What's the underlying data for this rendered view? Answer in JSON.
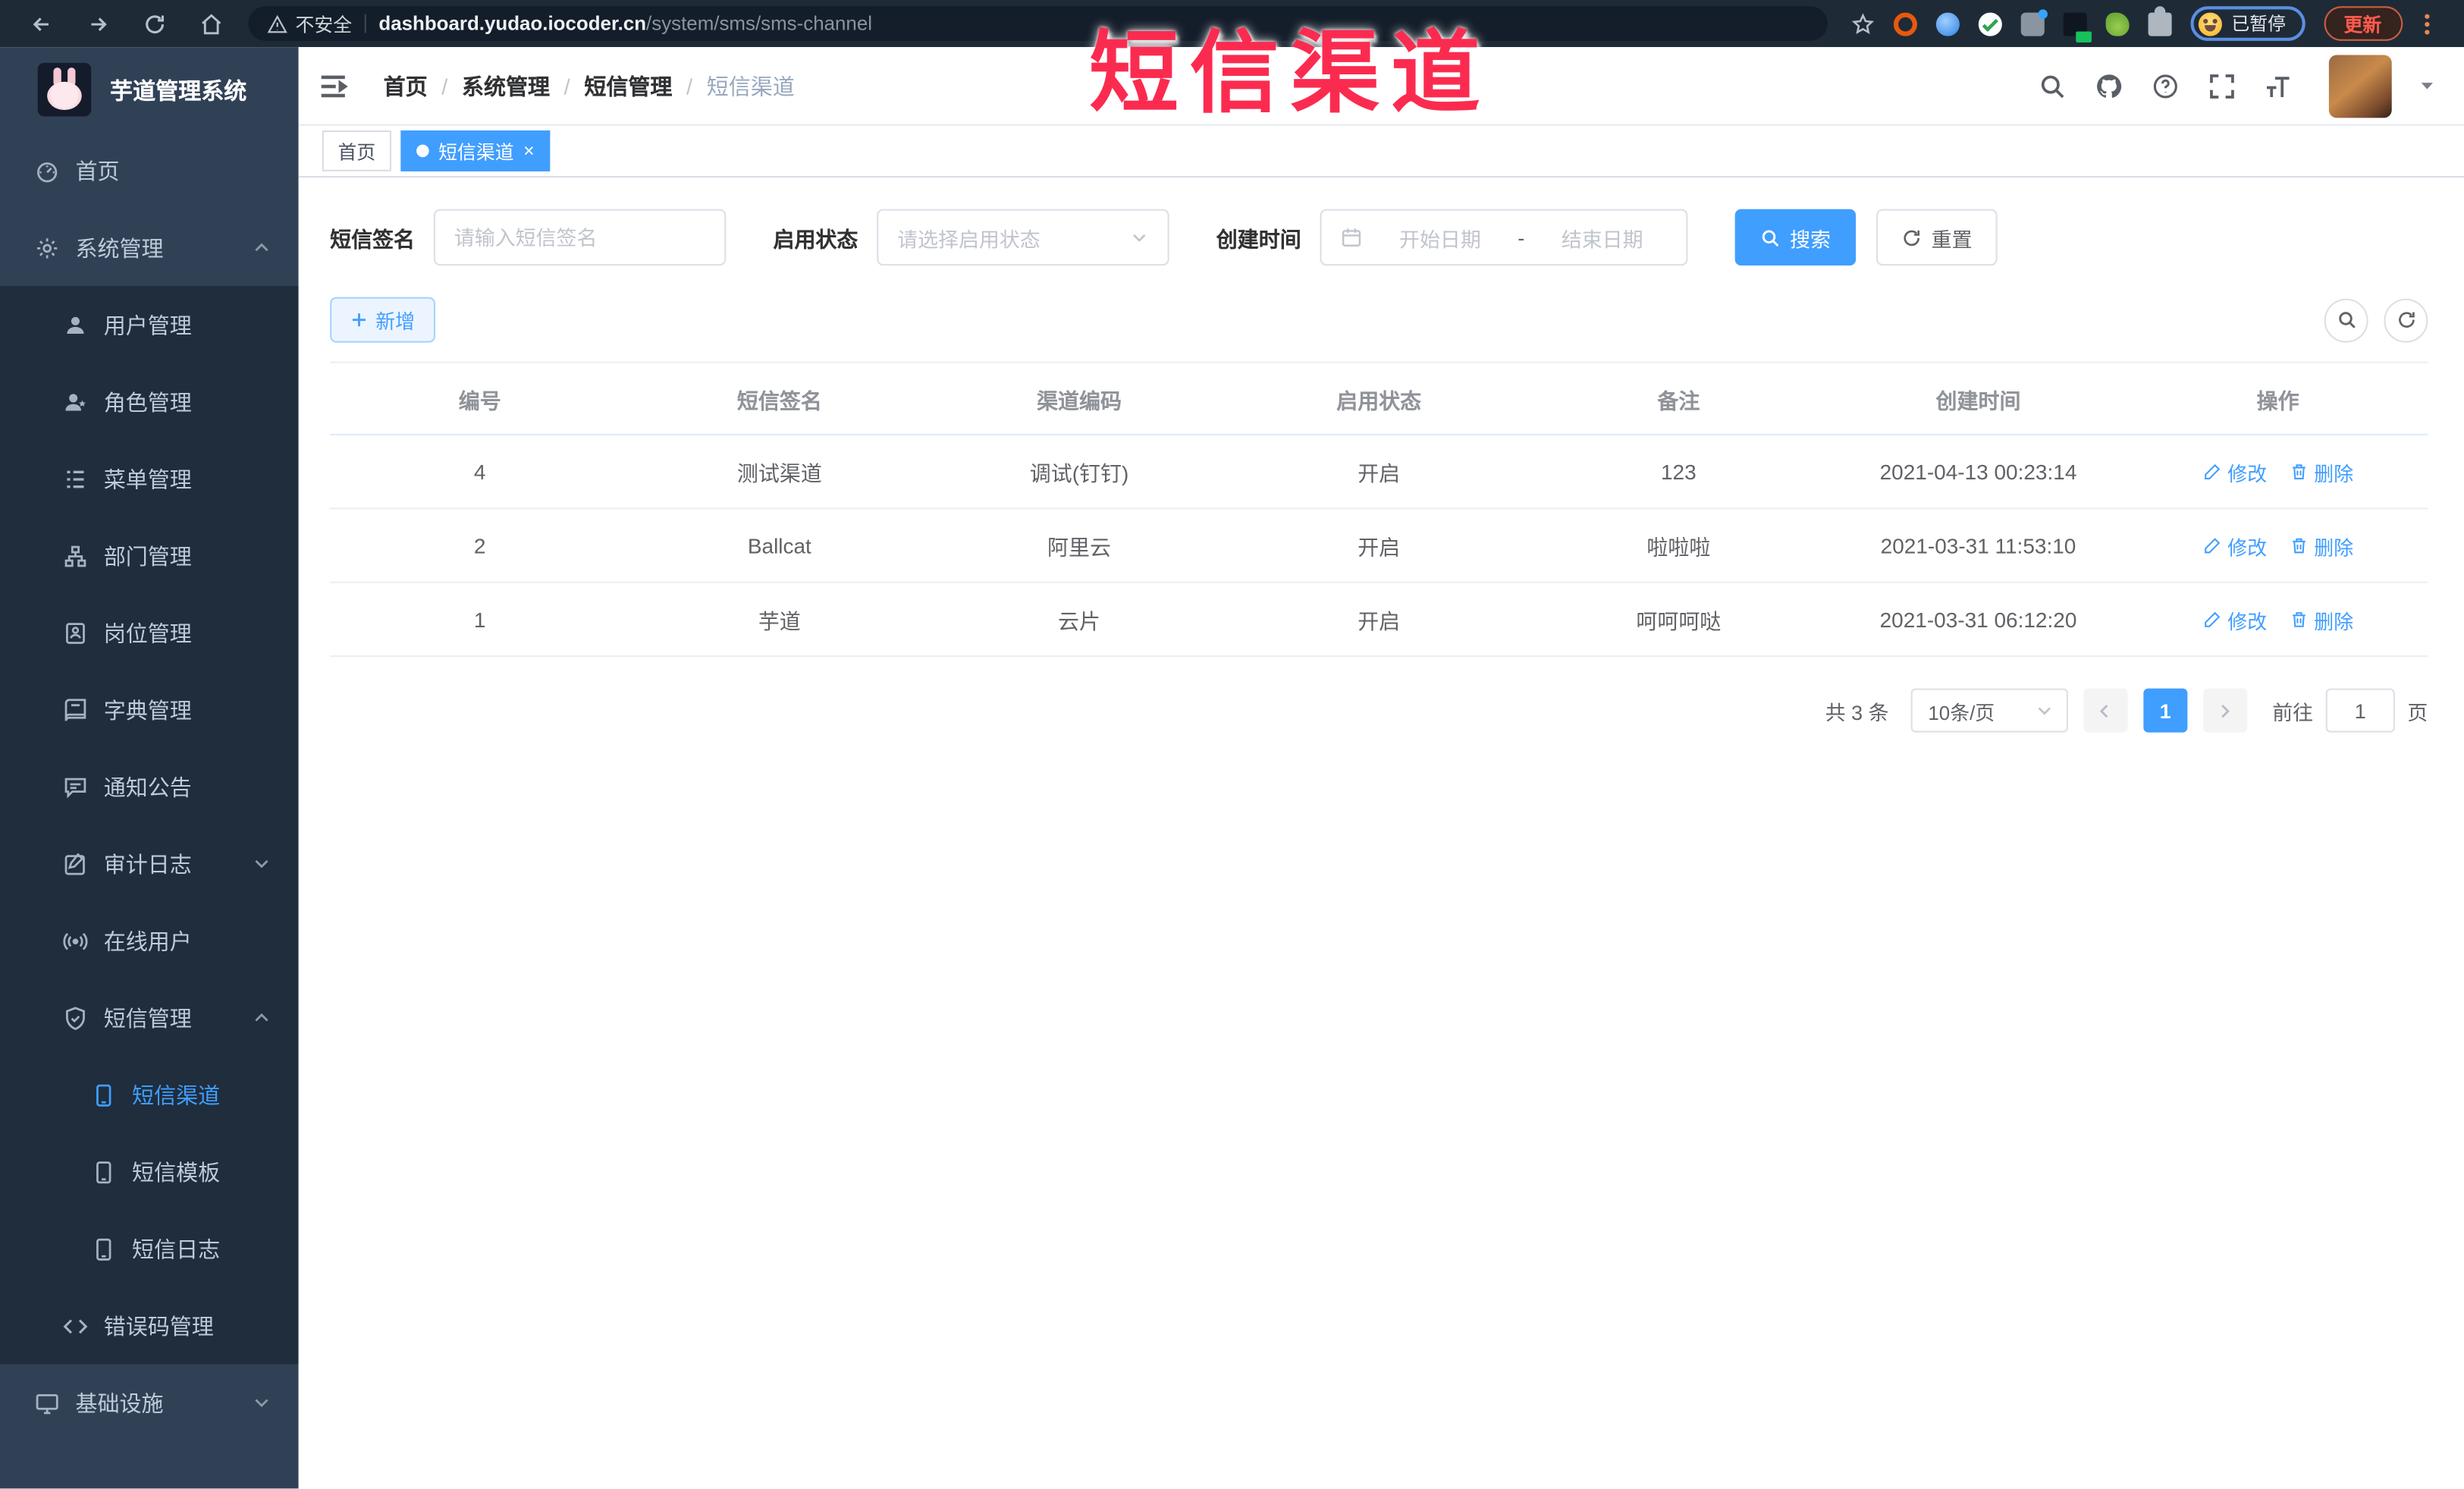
{
  "browser": {
    "security_label": "不安全",
    "url_host": "dashboard.yudao.iocoder.cn",
    "url_path": "/system/sms/sms-channel",
    "profile_badge": "已暂停",
    "update_button": "更新"
  },
  "overlay": {
    "title": "短信渠道",
    "color": "#fb2b50"
  },
  "sidebar": {
    "app_title": "芋道管理系统",
    "menu": [
      {
        "label": "首页",
        "icon": "dashboard-icon"
      },
      {
        "label": "系统管理",
        "icon": "gear-icon",
        "state": "expanded"
      },
      {
        "label": "用户管理",
        "icon": "user-icon"
      },
      {
        "label": "角色管理",
        "icon": "role-icon"
      },
      {
        "label": "菜单管理",
        "icon": "menu-list-icon"
      },
      {
        "label": "部门管理",
        "icon": "org-tree-icon"
      },
      {
        "label": "岗位管理",
        "icon": "post-badge-icon"
      },
      {
        "label": "字典管理",
        "icon": "dictionary-icon"
      },
      {
        "label": "通知公告",
        "icon": "announcement-icon"
      },
      {
        "label": "审计日志",
        "icon": "audit-log-icon",
        "state": "collapsed"
      },
      {
        "label": "在线用户",
        "icon": "online-user-icon"
      },
      {
        "label": "短信管理",
        "icon": "sms-shield-icon",
        "state": "expanded"
      },
      {
        "label": "短信渠道",
        "icon": "phone-icon",
        "active": true
      },
      {
        "label": "短信模板",
        "icon": "phone-icon"
      },
      {
        "label": "短信日志",
        "icon": "phone-icon"
      },
      {
        "label": "错误码管理",
        "icon": "code-icon"
      },
      {
        "label": "基础设施",
        "icon": "monitor-icon",
        "state": "collapsed"
      }
    ]
  },
  "header": {
    "breadcrumb": [
      "首页",
      "系统管理",
      "短信管理",
      "短信渠道"
    ],
    "separator": "/"
  },
  "tabs": [
    {
      "label": "首页"
    },
    {
      "label": "短信渠道",
      "active": true,
      "close": "×"
    }
  ],
  "search": {
    "signature_label": "短信签名",
    "signature_placeholder": "请输入短信签名",
    "status_label": "启用状态",
    "status_placeholder": "请选择启用状态",
    "time_label": "创建时间",
    "start_placeholder": "开始日期",
    "range_separator": "-",
    "end_placeholder": "结束日期",
    "search_button": "搜索",
    "reset_button": "重置"
  },
  "toolbar": {
    "add_button": "新增"
  },
  "table": {
    "headers": [
      "编号",
      "短信签名",
      "渠道编码",
      "启用状态",
      "备注",
      "创建时间",
      "操作"
    ],
    "edit_label": "修改",
    "delete_label": "删除",
    "rows": [
      {
        "id": "4",
        "signature": "测试渠道",
        "code": "调试(钉钉)",
        "status": "开启",
        "remark": "123",
        "created": "2021-04-13 00:23:14"
      },
      {
        "id": "2",
        "signature": "Ballcat",
        "code": "阿里云",
        "status": "开启",
        "remark": "啦啦啦",
        "created": "2021-03-31 11:53:10"
      },
      {
        "id": "1",
        "signature": "芋道",
        "code": "云片",
        "status": "开启",
        "remark": "呵呵呵哒",
        "created": "2021-03-31 06:12:20"
      }
    ]
  },
  "pagination": {
    "total": "共 3 条",
    "page_size": "10条/页",
    "current_page": "1",
    "goto_label": "前往",
    "goto_value": "1",
    "page_label": "页"
  },
  "colors": {
    "accent": "#409EFF",
    "sidebar_bg": "#304156",
    "submenu_bg": "#1f2d3d",
    "overlay_red": "#fb2b50",
    "browser_bar": "#1f2a37"
  }
}
